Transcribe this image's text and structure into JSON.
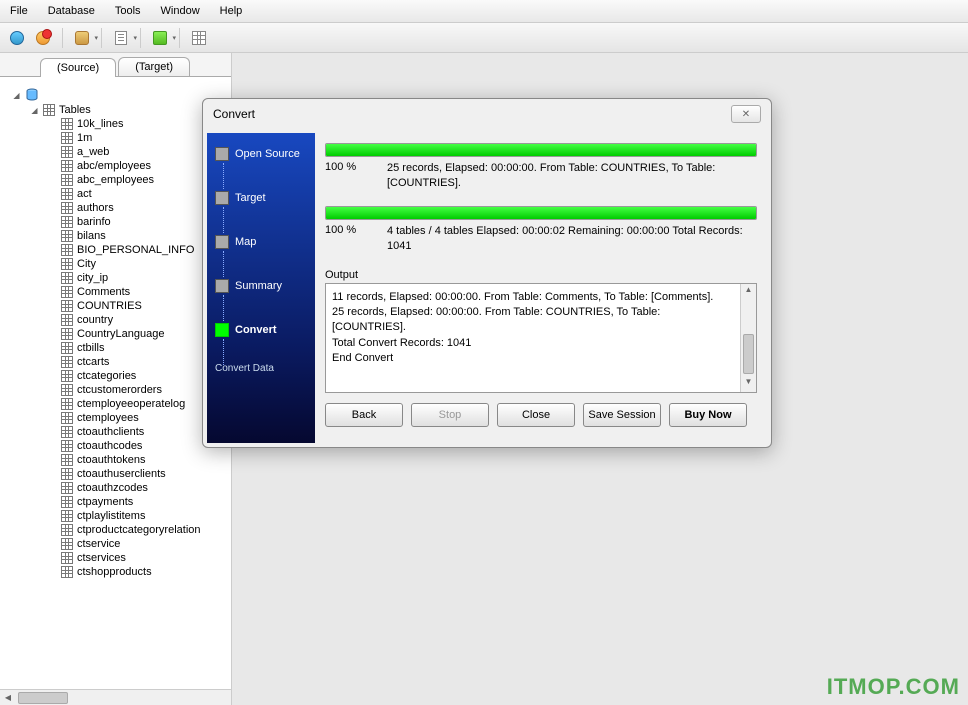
{
  "menu": {
    "items": [
      "File",
      "Database",
      "Tools",
      "Window",
      "Help"
    ]
  },
  "tabs": {
    "source": "(Source)",
    "target": "(Target)"
  },
  "tree": {
    "root": "Tables",
    "items": [
      "10k_lines",
      "1m",
      "a_web",
      "abc/employees",
      "abc_employees",
      "act",
      "authors",
      "barinfo",
      "bilans",
      "BIO_PERSONAL_INFO",
      "City",
      "city_ip",
      "Comments",
      "COUNTRIES",
      "country",
      "CountryLanguage",
      "ctbills",
      "ctcarts",
      "ctcategories",
      "ctcustomerorders",
      "ctemployeeoperatelog",
      "ctemployees",
      "ctoauthclients",
      "ctoauthcodes",
      "ctoauthtokens",
      "ctoauthuserclients",
      "ctoauthzcodes",
      "ctpayments",
      "ctplaylistitems",
      "ctproductcategoryrelation",
      "ctservice",
      "ctservices",
      "ctshopproducts"
    ]
  },
  "dialog": {
    "title": "Convert",
    "wizard": {
      "steps": [
        "Open Source",
        "Target",
        "Map",
        "Summary",
        "Convert"
      ],
      "active_index": 4,
      "subtitle": "Convert Data"
    },
    "progress1": {
      "percent": "100 %",
      "fill": 100,
      "info": "25 records,   Elapsed: 00:00:00.   From Table: COUNTRIES,   To Table: [COUNTRIES]."
    },
    "progress2": {
      "percent": "100 %",
      "fill": 100,
      "info": "4 tables / 4 tables   Elapsed: 00:00:02   Remaining: 00:00:00   Total Records: 1041"
    },
    "output_label": "Output",
    "output_lines": [
      "11 records,   Elapsed: 00:00:00.   From Table: Comments,   To Table: [Comments].",
      "25 records,   Elapsed: 00:00:00.   From Table: COUNTRIES,   To Table: [COUNTRIES].",
      "Total Convert Records: 1041",
      "End Convert"
    ],
    "buttons": {
      "back": "Back",
      "stop": "Stop",
      "close": "Close",
      "save": "Save Session",
      "buy": "Buy Now"
    }
  },
  "watermark": "ITMOP.COM"
}
